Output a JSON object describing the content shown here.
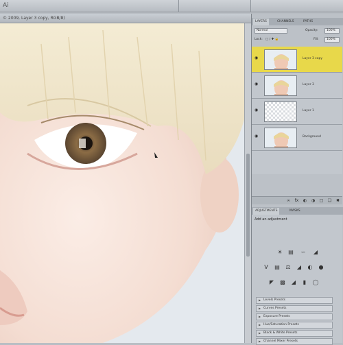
{
  "app": {
    "menu_glyph": "Ai"
  },
  "document": {
    "tab_title": "© 2009, Layer 3 copy, RGB/8)",
    "canvas_alt": "portrait close-up"
  },
  "layers_panel": {
    "tabs": [
      "LAYERS",
      "CHANNELS",
      "PATHS"
    ],
    "active_tab": 0,
    "blend_mode": "Normal",
    "opacity_label": "Opacity:",
    "opacity_value": "100%",
    "lock_label": "Lock:",
    "fill_label": "Fill:",
    "fill_value": "100%",
    "layers": [
      {
        "name": "Layer 3 copy",
        "active": true,
        "thumb": "portrait"
      },
      {
        "name": "Layer 3",
        "active": false,
        "thumb": "portrait"
      },
      {
        "name": "Layer 1",
        "active": false,
        "thumb": "transparent"
      },
      {
        "name": "Background",
        "active": false,
        "thumb": "portrait"
      }
    ]
  },
  "adjustments_panel": {
    "tabs": [
      "ADJUSTMENTS",
      "MASKS"
    ],
    "active_tab": 0,
    "title": "Add an adjustment",
    "presets": [
      "Levels Presets",
      "Curves Presets",
      "Exposure Presets",
      "Hue/Saturation Presets",
      "Black & White Presets",
      "Channel Mixer Presets"
    ]
  },
  "colors": {
    "active_layer": "#e8d84a",
    "panel_bg": "#c2c7cd"
  }
}
